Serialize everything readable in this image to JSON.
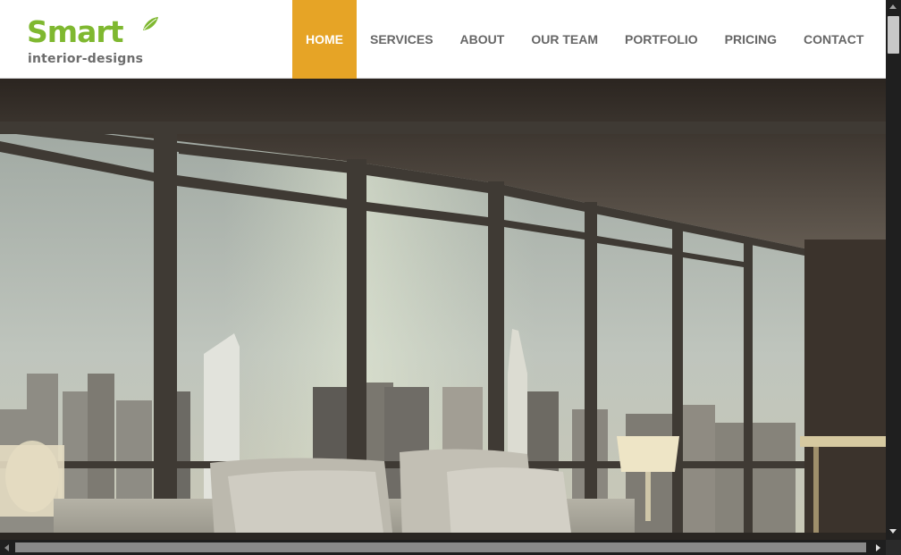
{
  "brand": {
    "name": "Smart",
    "tagline": "interior-designs",
    "accent_color": "#7fb830",
    "leaf_icon": "leaf-icon"
  },
  "nav": {
    "active_color": "#e6a426",
    "items": [
      {
        "label": "HOME",
        "active": true
      },
      {
        "label": "SERVICES",
        "active": false
      },
      {
        "label": "ABOUT",
        "active": false
      },
      {
        "label": "OUR TEAM",
        "active": false
      },
      {
        "label": "PORTFOLIO",
        "active": false
      },
      {
        "label": "PRICING",
        "active": false
      },
      {
        "label": "CONTACT",
        "active": false
      }
    ]
  },
  "hero": {
    "image": "living-room-city-view-photo"
  }
}
